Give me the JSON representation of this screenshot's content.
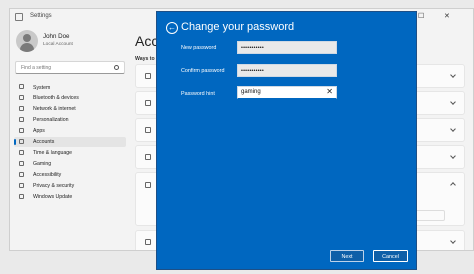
{
  "window": {
    "title": "Settings",
    "controls": [
      "—",
      "☐",
      "✕"
    ]
  },
  "user": {
    "name": "John Doe",
    "account_type": "Local Account"
  },
  "search": {
    "placeholder": "Find a setting"
  },
  "nav": {
    "items": [
      {
        "label": "System",
        "icon": "monitor-icon"
      },
      {
        "label": "Bluetooth & devices",
        "icon": "bluetooth-icon"
      },
      {
        "label": "Network & internet",
        "icon": "wifi-icon"
      },
      {
        "label": "Personalization",
        "icon": "brush-icon"
      },
      {
        "label": "Apps",
        "icon": "apps-icon"
      },
      {
        "label": "Accounts",
        "icon": "person-icon",
        "active": true
      },
      {
        "label": "Time & language",
        "icon": "clock-icon"
      },
      {
        "label": "Gaming",
        "icon": "gamepad-icon"
      },
      {
        "label": "Accessibility",
        "icon": "accessibility-icon"
      },
      {
        "label": "Privacy & security",
        "icon": "shield-icon"
      },
      {
        "label": "Windows Update",
        "icon": "update-icon"
      }
    ]
  },
  "main": {
    "title": "Acco",
    "subtitle": "Ways to"
  },
  "dialog": {
    "title": "Change your password",
    "new_password_label": "New password",
    "new_password_value": "•••••••••••",
    "confirm_password_label": "Confirm password",
    "confirm_password_value": "•••••••••••",
    "hint_label": "Password hint",
    "hint_value": "gaming",
    "clear_glyph": "✕",
    "back_glyph": "←",
    "next_label": "Next",
    "cancel_label": "Cancel"
  },
  "colors": {
    "accent": "#0067c0",
    "dialog_bg": "#0067c0",
    "window_bg": "#f3f3f3"
  }
}
